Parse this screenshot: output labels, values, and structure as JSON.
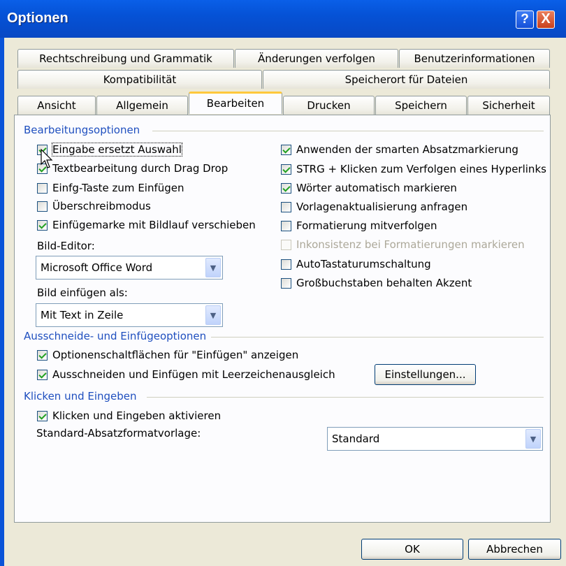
{
  "window": {
    "title": "Optionen",
    "help_label": "?",
    "close_label": "X"
  },
  "tabs": {
    "row1": [
      "Rechtschreibung und Grammatik",
      "Änderungen verfolgen",
      "Benutzerinformationen"
    ],
    "row2": [
      "Kompatibilität",
      "Speicherort für Dateien"
    ],
    "row3": [
      "Ansicht",
      "Allgemein",
      "Bearbeiten",
      "Drucken",
      "Speichern",
      "Sicherheit"
    ],
    "active": "Bearbeiten"
  },
  "editing": {
    "group_label": "Bearbeitungsoptionen",
    "left_options": [
      {
        "label": "Eingabe ersetzt Auswahl",
        "checked": true
      },
      {
        "label": "Textbearbeitung durch Drag  Drop",
        "checked": true
      },
      {
        "label": "Einfg-Taste zum Einfügen",
        "checked": false
      },
      {
        "label": "Überschreibmodus",
        "checked": false
      },
      {
        "label": "Einfügemarke mit Bildlauf verschieben",
        "checked": true
      }
    ],
    "picture_editor_label": "Bild-Editor:",
    "picture_editor_value": "Microsoft Office Word",
    "insert_picture_label": "Bild einfügen als:",
    "insert_picture_value": "Mit Text in Zeile",
    "right_options": [
      {
        "label": "Anwenden der smarten Absatzmarkierung",
        "checked": true
      },
      {
        "label": "STRG + Klicken zum Verfolgen eines Hyperlinks",
        "checked": true
      },
      {
        "label": "Wörter automatisch markieren",
        "checked": true
      },
      {
        "label": "Vorlagenaktualisierung anfragen",
        "checked": false
      },
      {
        "label": "Formatierung mitverfolgen",
        "checked": false
      },
      {
        "label": "Inkonsistenz bei Formatierungen markieren",
        "checked": false,
        "disabled": true
      },
      {
        "label": "AutoTastaturumschaltung",
        "checked": false
      },
      {
        "label": "Großbuchstaben behalten Akzent",
        "checked": false
      }
    ]
  },
  "cut_paste": {
    "group_label": "Ausschneide- und Einfügeoptionen",
    "options": [
      {
        "label": "Optionenschaltflächen für \"Einfügen\" anzeigen",
        "checked": true
      },
      {
        "label": "Ausschneiden und Einfügen mit Leerzeichenausgleich",
        "checked": true
      }
    ],
    "settings_button": "Einstellungen..."
  },
  "click_type": {
    "group_label": "Klicken und Eingeben",
    "option": {
      "label": "Klicken und Eingeben aktivieren",
      "checked": true
    },
    "default_style_label": "Standard-Absatzformatvorlage:",
    "default_style_value": "Standard"
  },
  "footer": {
    "ok": "OK",
    "cancel": "Abbrechen"
  },
  "icons": {
    "dropdown": "chevron-down-icon",
    "pointer": "mouse-pointer-icon"
  }
}
